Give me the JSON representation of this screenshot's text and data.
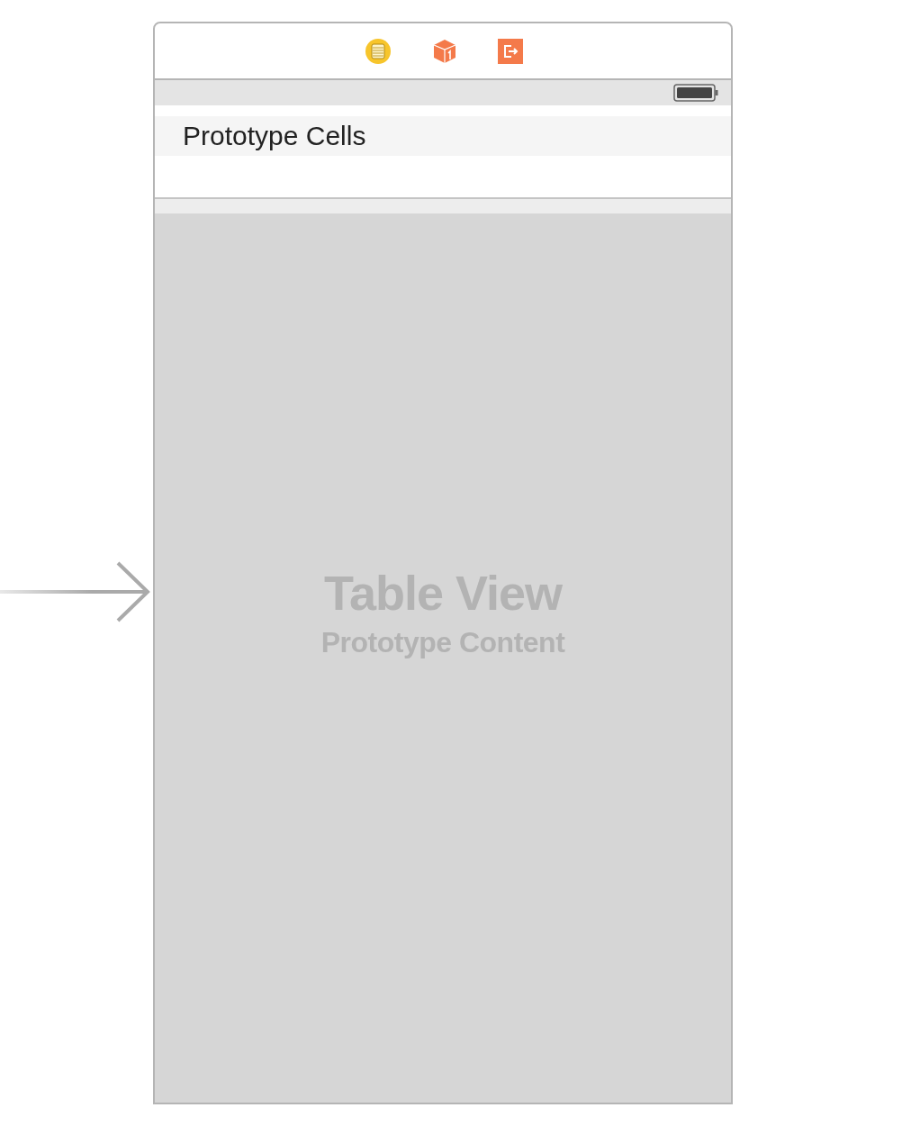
{
  "table_header": {
    "title": "Prototype Cells"
  },
  "table_view": {
    "title": "Table View",
    "subtitle": "Prototype Content"
  }
}
